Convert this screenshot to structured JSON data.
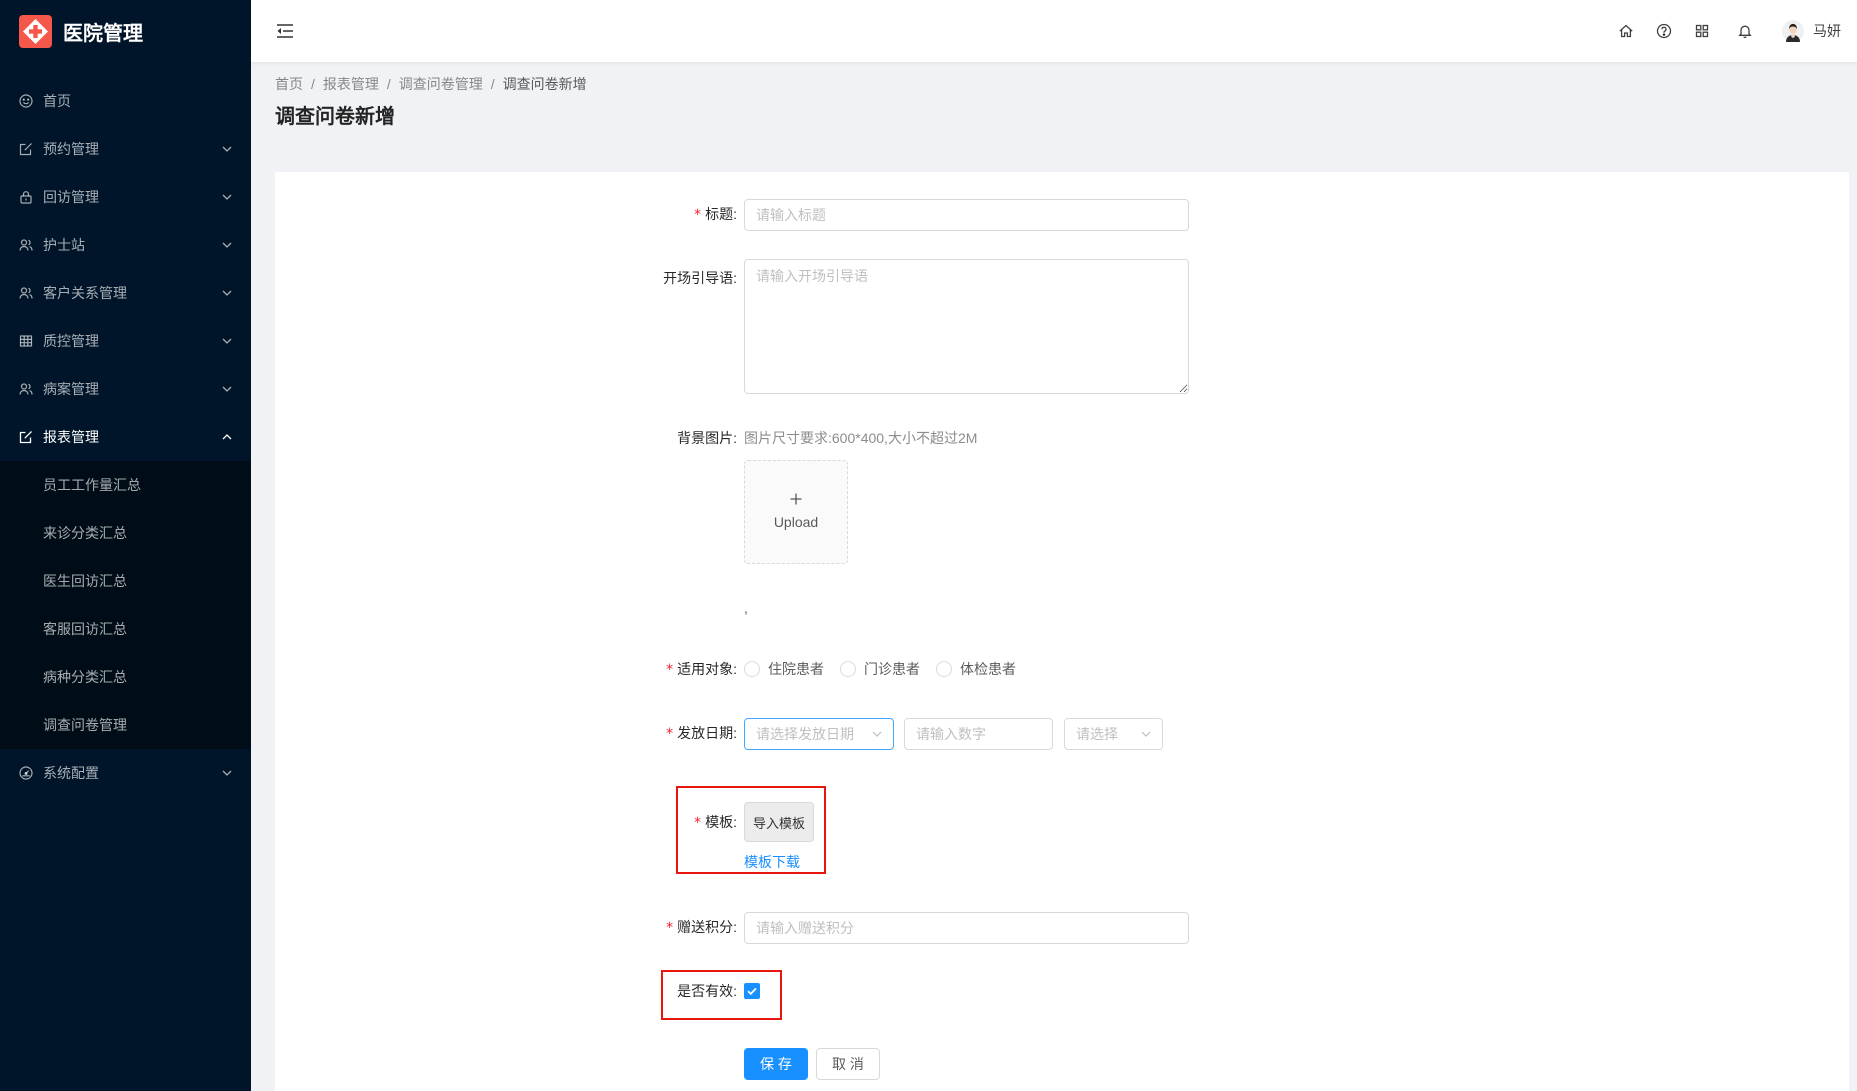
{
  "app": {
    "title": "医院管理",
    "logo_icon": "hospital-logo-icon"
  },
  "sidebar": {
    "items": [
      {
        "label": "首页",
        "icon": "smile-icon"
      },
      {
        "label": "预约管理",
        "icon": "form-icon"
      },
      {
        "label": "回访管理",
        "icon": "lock-icon"
      },
      {
        "label": "护士站",
        "icon": "team-icon"
      },
      {
        "label": "客户关系管理",
        "icon": "team-icon"
      },
      {
        "label": "质控管理",
        "icon": "table-icon"
      },
      {
        "label": "病案管理",
        "icon": "team-icon"
      },
      {
        "label": "报表管理",
        "icon": "form-icon",
        "expanded": true,
        "children": [
          {
            "label": "员工工作量汇总"
          },
          {
            "label": "来诊分类汇总"
          },
          {
            "label": "医生回访汇总"
          },
          {
            "label": "客服回访汇总"
          },
          {
            "label": "病种分类汇总"
          },
          {
            "label": "调查问卷管理"
          }
        ]
      },
      {
        "label": "系统配置",
        "icon": "dashboard-icon"
      }
    ]
  },
  "header": {
    "icons": [
      "menu-fold-icon",
      "home-icon",
      "question-circle-icon",
      "appstore-icon",
      "bell-icon"
    ],
    "user_name": "马妍"
  },
  "breadcrumb": {
    "separator": "/",
    "items": [
      "首页",
      "报表管理",
      "调查问卷管理",
      "调查问卷新增"
    ]
  },
  "page": {
    "title": "调查问卷新增"
  },
  "form": {
    "required_mark": "*",
    "title": {
      "label": "标题:",
      "required": true,
      "placeholder": "请输入标题"
    },
    "intro": {
      "label": "开场引导语:",
      "required": false,
      "placeholder": "请输入开场引导语"
    },
    "background_image": {
      "label": "背景图片:",
      "required": false,
      "hint": "图片尺寸要求:600*400,大小不超过2M",
      "upload_label": "Upload",
      "note": ","
    },
    "target": {
      "label": "适用对象:",
      "required": true,
      "options": [
        "住院患者",
        "门诊患者",
        "体检患者"
      ]
    },
    "issue_date": {
      "label": "发放日期:",
      "required": true,
      "date_placeholder": "请选择发放日期",
      "number_placeholder": "请输入数字",
      "select_placeholder": "请选择"
    },
    "template": {
      "label": "模板:",
      "required": true,
      "import_button": "导入模板",
      "download_link": "模板下载"
    },
    "points": {
      "label": "赠送积分:",
      "required": true,
      "placeholder": "请输入赠送积分"
    },
    "is_valid": {
      "label": "是否有效:",
      "required": false,
      "checked": true
    },
    "actions": {
      "save": "保 存",
      "cancel": "取 消"
    }
  },
  "colors": {
    "brand": "#f5574a",
    "sidebar_bg": "#001529",
    "submenu_bg": "#000c17",
    "primary": "#1890ff",
    "required": "#f5222d",
    "highlight_box": "#e8160c"
  }
}
